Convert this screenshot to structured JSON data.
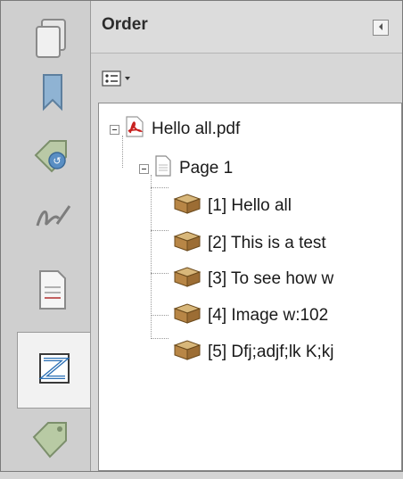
{
  "rail": {
    "buttons": [
      {
        "name": "pages-icon"
      },
      {
        "name": "bookmarks-icon"
      },
      {
        "name": "security-tag-icon"
      },
      {
        "name": "signatures-icon"
      },
      {
        "name": "document-icon"
      },
      {
        "name": "order-icon",
        "active": true
      },
      {
        "name": "tags-icon"
      }
    ]
  },
  "panel": {
    "title": "Order",
    "collapse_icon": "triangle-left-icon",
    "options_icon": "options-menu-icon"
  },
  "tree": {
    "root": {
      "label": "Hello all.pdf",
      "icon": "pdf-file-icon"
    },
    "page": {
      "label": "Page 1",
      "icon": "page-icon"
    },
    "items": [
      {
        "label": "[1]  Hello all",
        "icon": "content-box-icon"
      },
      {
        "label": "[2]  This is a test",
        "icon": "content-box-icon"
      },
      {
        "label": "[3]  To see how w",
        "icon": "content-box-icon"
      },
      {
        "label": "[4]  Image   w:102",
        "icon": "content-box-icon"
      },
      {
        "label": "[5]  Dfj;adjf;lk K;kj",
        "icon": "content-box-icon"
      }
    ]
  },
  "colors": {
    "rail_bg": "#cfcfcf",
    "panel_bg": "#d7d7d7",
    "tree_bg": "#ffffff",
    "pdf_red": "#c8201e",
    "box_brown": "#a8793a"
  }
}
